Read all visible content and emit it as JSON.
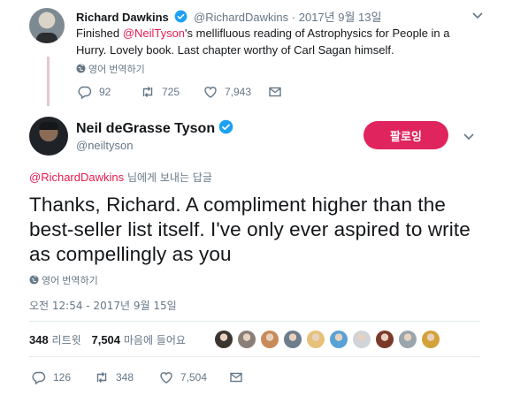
{
  "parent_tweet": {
    "author_name": "Richard Dawkins",
    "author_handle": "@RichardDawkins",
    "separator": "·",
    "date": "2017년 9월 13일",
    "text_before": "Finished ",
    "mention": "@NeilTyson",
    "text_after": "'s mellifluous reading of Astrophysics for People in a Hurry. Lovely book. Last chapter worthy of Carl Sagan himself.",
    "translate_label": "영어 번역하기",
    "replies": "92",
    "retweets": "725",
    "likes": "7,943"
  },
  "main_tweet": {
    "author_name": "Neil deGrasse Tyson",
    "author_handle": "@neiltyson",
    "follow_label": "팔로잉",
    "reply_to_mention": "@RichardDawkins",
    "reply_to_suffix": " 님에게 보내는 답글",
    "text": "Thanks, Richard. A compliment higher than the best-seller list itself. I've only ever aspired to write as compellingly as you",
    "translate_label": "영어 번역하기",
    "timestamp": "오전 12:54 - 2017년 9월 15일",
    "retweet_count": "348",
    "retweet_label": "리트윗",
    "like_count": "7,504",
    "like_label": "마음에 들어요",
    "liker_colors": [
      "#3b3530",
      "#8a7f78",
      "#c98a5a",
      "#6e7c8c",
      "#e6c17a",
      "#5aa2d6",
      "#d0d4d8",
      "#7a3a2a",
      "#9aa5ad",
      "#d4a23a"
    ],
    "action_replies": "126",
    "action_retweets": "348",
    "action_likes": "7,504"
  },
  "colors": {
    "accent": "#e81c4f",
    "follow_button": "#e0245e",
    "verified": "#1da1f2",
    "muted_text": "#657786",
    "thread_line": "#e1c6d6"
  },
  "icons": [
    "reply-icon",
    "retweet-icon",
    "like-icon",
    "message-icon",
    "globe-icon",
    "verified-badge-icon",
    "chevron-down-icon"
  ]
}
